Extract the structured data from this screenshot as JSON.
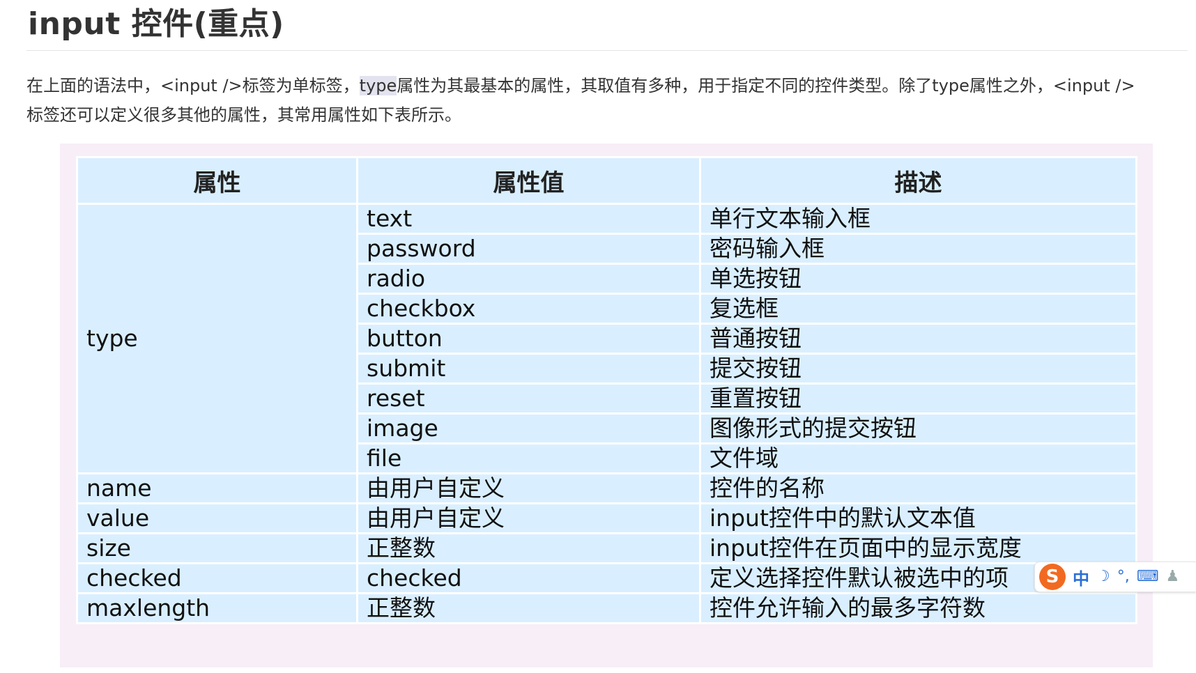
{
  "heading": {
    "title": "input 控件(重点)"
  },
  "intro": {
    "part1": "在上面的语法中，<input />标签为单标签，",
    "highlight": "type",
    "part2": "属性为其最基本的属性，其取值有多种，用于指定不同的控件类型。除了type属性之外，<input />标签还可以定义很多其他的属性，其常用属性如下表所示。"
  },
  "table": {
    "headers": [
      "属性",
      "属性值",
      "描述"
    ],
    "type_attr": "type",
    "type_rows": [
      {
        "value": "text",
        "desc": "单行文本输入框"
      },
      {
        "value": "password",
        "desc": "密码输入框"
      },
      {
        "value": "radio",
        "desc": "单选按钮"
      },
      {
        "value": "checkbox",
        "desc": "复选框"
      },
      {
        "value": "button",
        "desc": "普通按钮"
      },
      {
        "value": "submit",
        "desc": "提交按钮"
      },
      {
        "value": "reset",
        "desc": "重置按钮"
      },
      {
        "value": "image",
        "desc": "图像形式的提交按钮"
      },
      {
        "value": "file",
        "desc": "文件域"
      }
    ],
    "other_rows": [
      {
        "attr": "name",
        "value": "由用户自定义",
        "desc": "控件的名称"
      },
      {
        "attr": "value",
        "value": "由用户自定义",
        "desc": "input控件中的默认文本值"
      },
      {
        "attr": "size",
        "value": "正整数",
        "desc": "input控件在页面中的显示宽度"
      },
      {
        "attr": "checked",
        "value": "checked",
        "desc": "定义选择控件默认被选中的项"
      },
      {
        "attr": "maxlength",
        "value": "正整数",
        "desc": "控件允许输入的最多字符数"
      }
    ]
  },
  "ime_toolbar": {
    "logo": "S",
    "mode": "中",
    "icons": [
      "moon-icon",
      "punctuation-icon",
      "keyboard-icon",
      "user-icon"
    ]
  }
}
